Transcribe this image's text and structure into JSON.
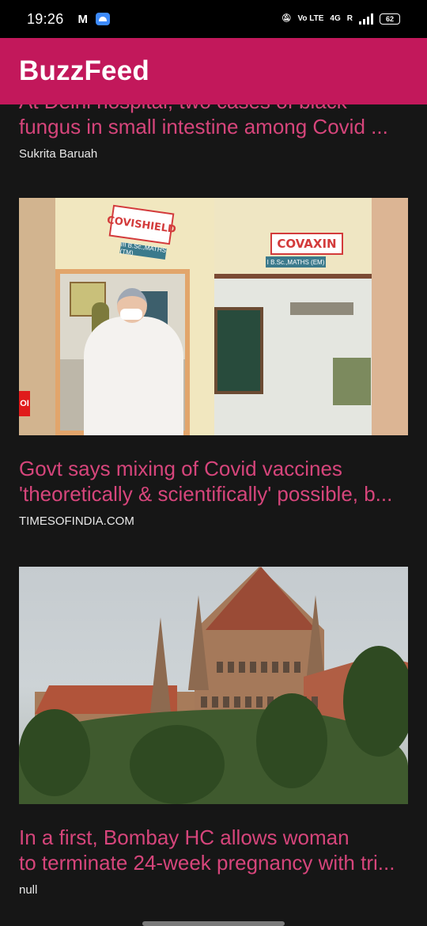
{
  "status_bar": {
    "time": "19:26",
    "network_label": "Vo LTE",
    "network_type": "4G",
    "roaming": "R",
    "battery": "62"
  },
  "app_bar": {
    "title": "BuzzFeed"
  },
  "articles": [
    {
      "headline_lines": [
        "At Delhi hospital, two cases of black",
        "fungus in small intestine among Covid ..."
      ],
      "source": "Sukrita Baruah"
    },
    {
      "headline_lines": [
        "Govt says mixing of Covid vaccines",
        "'theoretically & scientifically' possible, b..."
      ],
      "source": "TIMESOFINDIA.COM",
      "image_text": {
        "sign_left": "COVISHIELD",
        "sign_right": "COVAXIN",
        "sub_left": "III B.Sc.,MATHS (TM)",
        "sub_right": "I B.Sc.,MATHS (EM)",
        "badge": "OI"
      }
    },
    {
      "headline_lines": [
        "In a first, Bombay HC allows woman",
        "to terminate 24-week pregnancy with tri..."
      ],
      "source": "null"
    }
  ]
}
